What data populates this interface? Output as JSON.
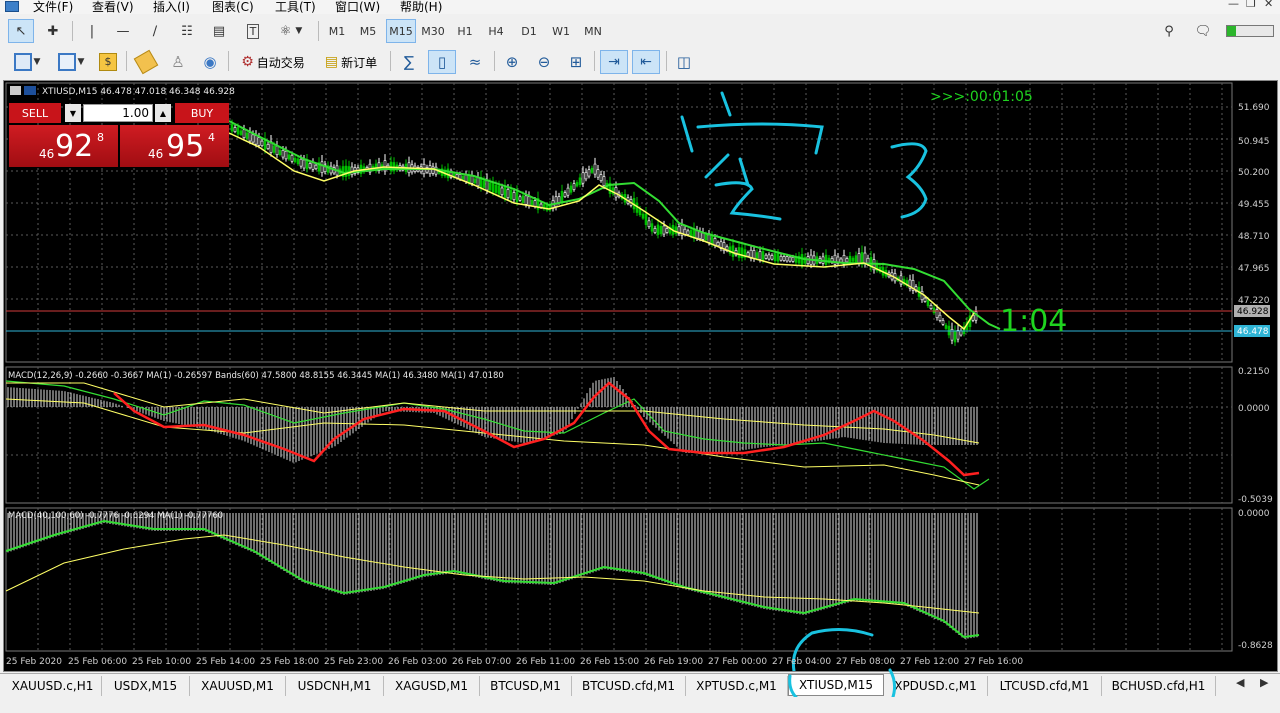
{
  "menu": {
    "items": [
      "文件(F)",
      "查看(V)",
      "插入(I)",
      "图表(C)",
      "工具(T)",
      "窗口(W)",
      "帮助(H)"
    ]
  },
  "toolbar": {
    "timeframes": [
      "M1",
      "M5",
      "M15",
      "M30",
      "H1",
      "H4",
      "D1",
      "W1",
      "MN"
    ],
    "active_timeframe": "M15",
    "autotrade_label": "自动交易",
    "neworder_label": "新订单"
  },
  "chart": {
    "symbol_info": "XTIUSD,M15  46.478 47.018 46.348 46.928",
    "countdown_top": ">>>:00:01:05",
    "countdown_big": "1:04",
    "ask_price_tag": "46.928",
    "bid_price_tag": "46.478",
    "price_axis": [
      "51.690",
      "50.945",
      "50.200",
      "49.455",
      "48.710",
      "47.965",
      "47.220"
    ],
    "macd1_label": "MACD(12,26,9) -0.2660 -0.3667 MA(1) -0.26597 Bands(60) 47.5800 48.8155 46.3445 MA(1) 46.3480 MA(1) 47.0180",
    "macd1_axis": [
      "0.2150",
      "0.0000",
      "-0.5039"
    ],
    "macd2_label": "MACD(40,100,60) -0.7776 -0.6294 MA(1) -0.77760",
    "macd2_axis": [
      "0.0000",
      "-0.8628"
    ],
    "time_axis": [
      "25 Feb 2020",
      "25 Feb 06:00",
      "25 Feb 10:00",
      "25 Feb 14:00",
      "25 Feb 18:00",
      "25 Feb 23:00",
      "26 Feb 03:00",
      "26 Feb 07:00",
      "26 Feb 11:00",
      "26 Feb 15:00",
      "26 Feb 19:00",
      "27 Feb 00:00",
      "27 Feb 04:00",
      "27 Feb 08:00",
      "27 Feb 12:00",
      "27 Feb 16:00"
    ],
    "trade_panel": {
      "sell_label": "SELL",
      "buy_label": "BUY",
      "lot": "1.00",
      "sell_prefix": "46",
      "sell_main": "92",
      "sell_sup": "8",
      "buy_prefix": "46",
      "buy_main": "95",
      "buy_sup": "4"
    },
    "colors": {
      "candle_up": "#00c000",
      "ma_fast": "#ffff66",
      "ma_slow": "#33dd33",
      "macd_signal": "#ff2020",
      "grid": "#5a5a5a",
      "annotation": "#19c2e0"
    }
  },
  "tabs": {
    "items": [
      "XAUUSD.c,H1",
      "USDX,M15",
      "XAUUSD,M1",
      "USDCNH,M1",
      "XAGUSD,M1",
      "BTCUSD,M1",
      "BTCUSD.cfd,M1",
      "XPTUSD.c,M1",
      "XTIUSD,M15",
      "XPDUSD.c,M1",
      "LTCUSD.cfd,M1",
      "BCHUSD.cfd,H1"
    ],
    "active": "XTIUSD,M15"
  }
}
